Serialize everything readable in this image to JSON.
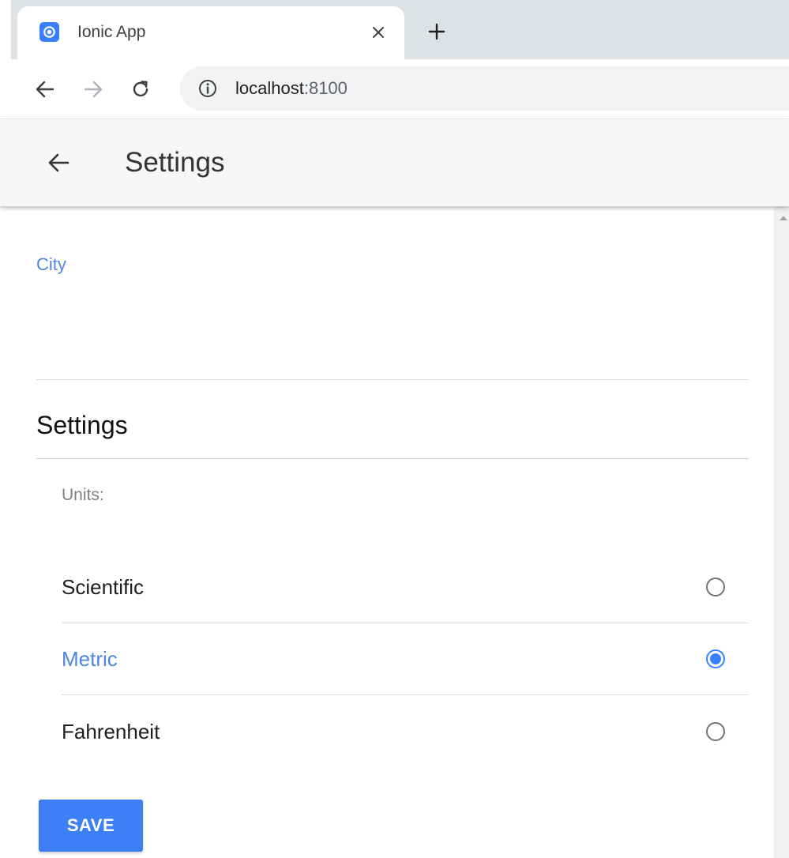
{
  "browser": {
    "tab": {
      "title": "Ionic App",
      "favicon": "ionic-logo-icon",
      "close_icon": "close-icon"
    },
    "new_tab_icon": "plus-icon",
    "nav": {
      "back_icon": "arrow-left-icon",
      "forward_icon": "arrow-right-icon",
      "reload_icon": "reload-icon",
      "info_icon": "info-icon"
    },
    "url": {
      "host": "localhost",
      "port": ":8100"
    }
  },
  "header": {
    "back_icon": "arrow-left-icon",
    "title": "Settings"
  },
  "form": {
    "city_label": "City",
    "city_value": "",
    "section_title": "Settings",
    "units_label": "Units:",
    "units_options": [
      {
        "label": "Scientific",
        "checked": false
      },
      {
        "label": "Metric",
        "checked": true
      },
      {
        "label": "Fahrenheit",
        "checked": false
      }
    ],
    "save_label": "SAVE"
  },
  "colors": {
    "accent": "#3880ff",
    "label_blue": "#4f86e0",
    "header_bg": "#f7f7f7",
    "tabstrip_bg": "#dee1e6"
  }
}
